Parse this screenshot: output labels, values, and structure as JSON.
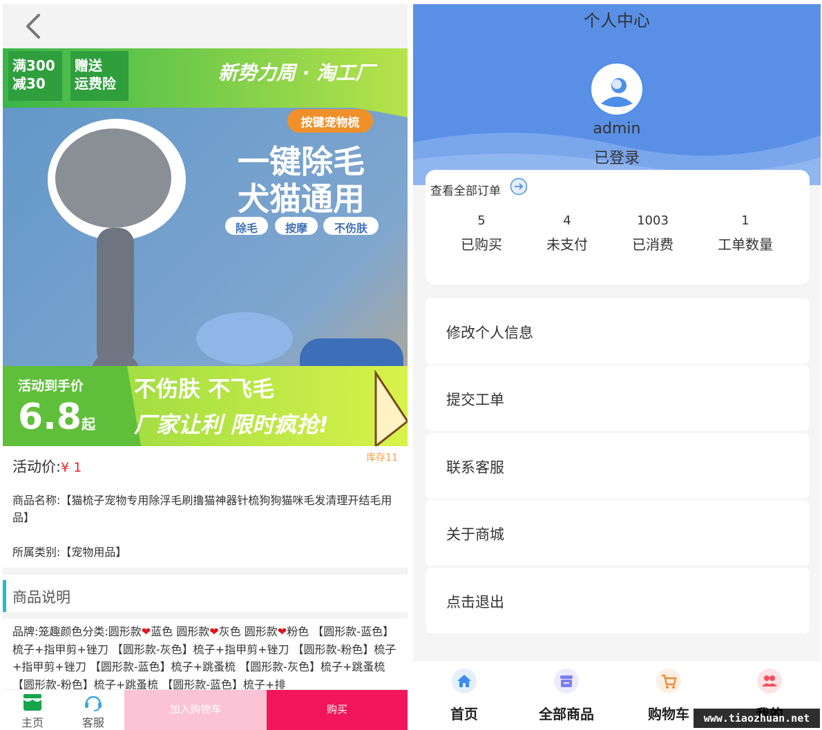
{
  "product": {
    "promo_badge_1": "满300减30",
    "promo_badge_1_a": "满300",
    "promo_badge_1_b": "减30",
    "promo_badge_2_a": "赠送",
    "promo_badge_2_b": "运费险",
    "brand_line": "新势力周 · 淘工厂",
    "tag": "按键宠物梳",
    "headline_1": "一键除毛",
    "headline_2": "犬猫通用",
    "features": [
      "除毛",
      "按摩",
      "不伤肤"
    ],
    "deal_label": "活动到手价",
    "deal_price": "6.8",
    "deal_suffix": "起",
    "slogan_1": "不伤肤 不飞毛",
    "slogan_2": "厂家让利 限时疯抢!",
    "price_label": "活动价:",
    "price": "¥ 1",
    "stock": "库存11",
    "name": "商品名称:【猫梳子宠物专用除浮毛刷撸猫神器针梳狗狗猫咪毛发清理开结毛用品】",
    "category": "所属类别:【宠物用品】",
    "desc_title": "商品说明",
    "desc_parts": {
      "p1": "品牌:笼趣颜色分类:圆形款",
      "p2": "蓝色 圆形款",
      "p3": "灰色 圆形款",
      "p4": "粉色 【圆形款-蓝色】梳子+指甲剪+锉刀 【圆形款-灰色】梳子+指甲剪+锉刀 【圆形款-粉色】梳子+指甲剪+锉刀 【圆形款-蓝色】梳子+跳蚤梳 【圆形款-灰色】梳子+跳蚤梳 【圆形款-粉色】梳子+跳蚤梳 【圆形款-蓝色】梳子+排"
    }
  },
  "left_bottom": {
    "home_label": "主页",
    "service_label": "客服",
    "cart_button": "加入购物车",
    "buy_button": "购买"
  },
  "profile": {
    "title": "个人中心",
    "username": "admin",
    "status": "已登录",
    "view_all_orders": "查看全部订单",
    "stats": [
      {
        "value": "5",
        "label": "已购买"
      },
      {
        "value": "4",
        "label": "未支付"
      },
      {
        "value": "1003",
        "label": "已消费"
      },
      {
        "value": "1",
        "label": "工单数量"
      }
    ],
    "menu": [
      "修改个人信息",
      "提交工单",
      "联系客服",
      "关于商城",
      "点击退出"
    ]
  },
  "tabbar": {
    "tabs": [
      {
        "label": "首页",
        "icon": "home-icon",
        "color": "#3d8cf0"
      },
      {
        "label": "全部商品",
        "icon": "store-icon",
        "color": "#7b7ff0"
      },
      {
        "label": "购物车",
        "icon": "cart-icon",
        "color": "#f08a3a"
      },
      {
        "label": "我的",
        "icon": "users-icon",
        "color": "#f0505a"
      }
    ]
  },
  "watermark": "www.tiaozhuan.net",
  "colors": {
    "hero_blue": "#5a8fe6",
    "buy_red": "#f1165c",
    "cart_pink": "#fcc2d5",
    "price_red": "#e8262a",
    "accent_cyan": "#22b9d2",
    "stock_orange": "#f0a04b"
  }
}
